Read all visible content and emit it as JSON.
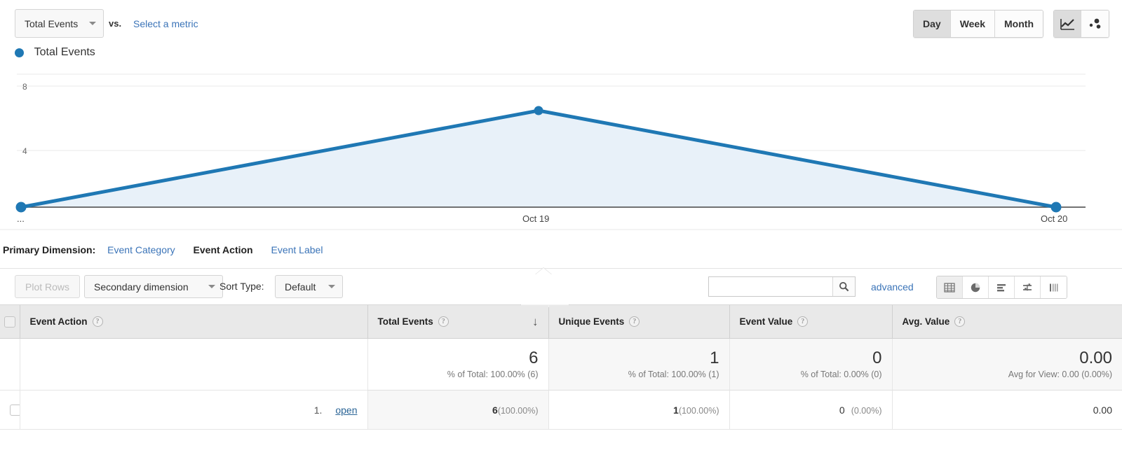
{
  "toolbar": {
    "metric_selected": "Total Events",
    "vs_label": "vs.",
    "select_metric_link": "Select a metric",
    "granularity": [
      {
        "label": "Day",
        "active": true
      },
      {
        "label": "Week",
        "active": false
      },
      {
        "label": "Month",
        "active": false
      }
    ],
    "chart_types": [
      {
        "name": "line-chart-icon",
        "active": true
      },
      {
        "name": "motion-chart-icon",
        "active": false
      }
    ]
  },
  "legend": {
    "series_label": "Total Events",
    "color": "#1f78b4"
  },
  "chart_data": {
    "type": "area",
    "title": "Total Events",
    "x": [
      "...",
      "Oct 19",
      "Oct 20"
    ],
    "categories": [
      "...",
      "Oct 19",
      "Oct 20"
    ],
    "values": [
      0,
      6,
      0
    ],
    "series": [
      {
        "name": "Total Events",
        "values": [
          0,
          6,
          0
        ],
        "color": "#1f78b4"
      }
    ],
    "ylabel": "",
    "xlabel": "",
    "yticks": [
      4,
      8
    ],
    "ylim": [
      0,
      8
    ],
    "grid": true,
    "legend_position": "top-left",
    "fill_color": "#e8f1f9",
    "point_markers": true
  },
  "slider": {
    "handle_icon": "chevron-down-icon"
  },
  "primary_dimension": {
    "label": "Primary Dimension:",
    "options": [
      {
        "label": "Event Category",
        "active": false
      },
      {
        "label": "Event Action",
        "active": true
      },
      {
        "label": "Event Label",
        "active": false
      }
    ]
  },
  "table_toolbar": {
    "plot_rows": "Plot Rows",
    "secondary_dimension": "Secondary dimension",
    "sort_type_label": "Sort Type:",
    "sort_type_value": "Default",
    "search_placeholder": "",
    "search_value": "",
    "search_icon": "search-icon",
    "advanced_link": "advanced",
    "view_buttons": [
      {
        "name": "table-view-icon",
        "active": true
      },
      {
        "name": "pie-view-icon",
        "active": false
      },
      {
        "name": "performance-view-icon",
        "active": false
      },
      {
        "name": "comparison-view-icon",
        "active": false
      },
      {
        "name": "pivot-view-icon",
        "active": false
      }
    ]
  },
  "table": {
    "columns": [
      {
        "label": "Event Action",
        "help": "?",
        "align": "left",
        "sorted": false
      },
      {
        "label": "Total Events",
        "help": "?",
        "align": "left",
        "sorted": true,
        "sort_dir": "↓"
      },
      {
        "label": "Unique Events",
        "help": "?",
        "align": "left",
        "sorted": false
      },
      {
        "label": "Event Value",
        "help": "?",
        "align": "left",
        "sorted": false
      },
      {
        "label": "Avg. Value",
        "help": "?",
        "align": "left",
        "sorted": false
      }
    ],
    "summary": {
      "total_events": {
        "value": "6",
        "sub": "% of Total: 100.00% (6)"
      },
      "unique_events": {
        "value": "1",
        "sub": "% of Total: 100.00% (1)"
      },
      "event_value": {
        "value": "0",
        "sub": "% of Total: 0.00% (0)"
      },
      "avg_value": {
        "value": "0.00",
        "sub": "Avg for View: 0.00 (0.00%)"
      }
    },
    "rows": [
      {
        "index": "1.",
        "name": "open",
        "total_events": "6",
        "total_events_pct": "(100.00%)",
        "unique_events": "1",
        "unique_events_pct": "(100.00%)",
        "event_value": "0",
        "event_value_pct": "(0.00%)",
        "avg_value": "0.00"
      }
    ]
  }
}
